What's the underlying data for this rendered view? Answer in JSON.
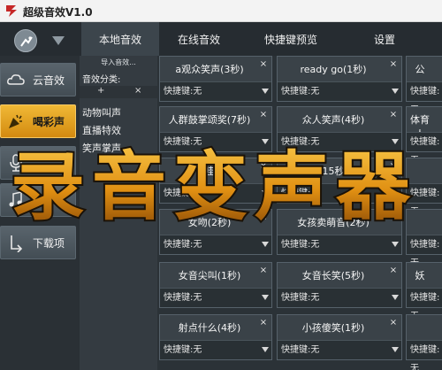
{
  "window": {
    "title": "超级音效V1.0"
  },
  "tabs": [
    {
      "label": "本地音效",
      "active": true
    },
    {
      "label": "在线音效",
      "active": false
    },
    {
      "label": "快捷键预览",
      "active": false
    },
    {
      "label": "设置",
      "active": false
    }
  ],
  "sidebar": {
    "items": [
      {
        "label": "云音效",
        "icon": "cloud-icon",
        "active": false
      },
      {
        "label": "喝彩声",
        "icon": "party-icon",
        "active": true
      },
      {
        "label": "",
        "icon": "microphone-icon",
        "active": false
      },
      {
        "label": "",
        "icon": "music-icon",
        "active": false
      },
      {
        "label": "下载项",
        "icon": "download-icon",
        "active": false
      }
    ]
  },
  "categories": {
    "import_label": "导入音效...",
    "title": "音效分类:",
    "add_label": "+",
    "remove_label": "×",
    "items": [
      "动物叫声",
      "直播特效",
      "笑声掌声"
    ]
  },
  "sound_cards": {
    "close_label": "×",
    "items": [
      {
        "name": "a观众笑声(3秒)",
        "hotkey": "快捷键:无"
      },
      {
        "name": "ready go(1秒)",
        "hotkey": "快捷键:无"
      },
      {
        "name": "公",
        "hotkey": "快捷键:无"
      },
      {
        "name": "人群鼓掌颂奖(7秒)",
        "hotkey": "快捷键:无"
      },
      {
        "name": "众人笑声(4秒)",
        "hotkey": "快捷键:无"
      },
      {
        "name": "体育人",
        "hotkey": "快捷键:无"
      },
      {
        "name": "哇",
        "hotkey": "快捷键:无"
      },
      {
        "name": "(15秒)",
        "hotkey": "快捷键:无"
      },
      {
        "name": "",
        "hotkey": "快捷键:无"
      },
      {
        "name": "女吻(2秒)",
        "hotkey": "快捷键:无"
      },
      {
        "name": "女孩卖萌音(2秒)",
        "hotkey": "快捷键:无"
      },
      {
        "name": "",
        "hotkey": "快捷键:无"
      },
      {
        "name": "女音尖叫(1秒)",
        "hotkey": "快捷键:无"
      },
      {
        "name": "女音长笑(5秒)",
        "hotkey": "快捷键:无"
      },
      {
        "name": "妖",
        "hotkey": "快捷键:无"
      },
      {
        "name": "射点什么(4秒)",
        "hotkey": "快捷键:无"
      },
      {
        "name": "小孩傻笑(1秒)",
        "hotkey": "快捷键:无"
      },
      {
        "name": "",
        "hotkey": "快捷键:无"
      }
    ]
  },
  "watermark": {
    "text": "录音变声器"
  },
  "colors": {
    "accent": "#e8a21f",
    "background": "#2b3237",
    "watermark_fill": "#e39b1c"
  }
}
